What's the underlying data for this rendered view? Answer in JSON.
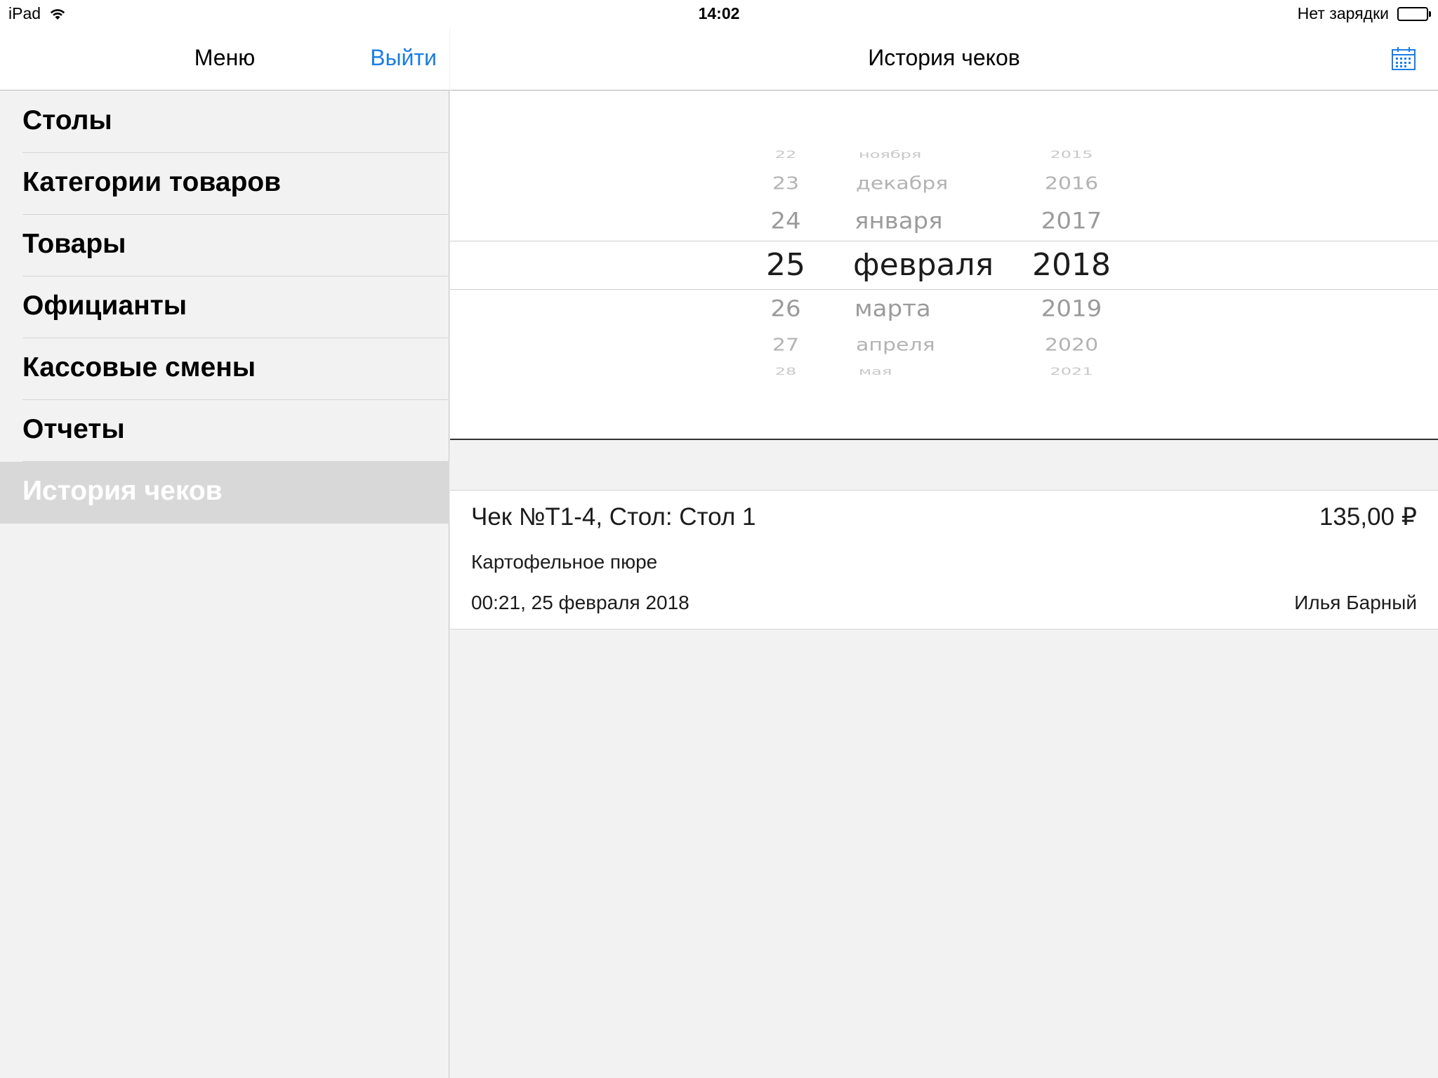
{
  "status_bar": {
    "device": "iPad",
    "time": "14:02",
    "charging": "Нет зарядки",
    "battery_level": 1.0
  },
  "sidebar": {
    "title": "Меню",
    "logout_label": "Выйти",
    "items": [
      {
        "label": "Столы"
      },
      {
        "label": "Категории товаров"
      },
      {
        "label": "Товары"
      },
      {
        "label": "Официанты"
      },
      {
        "label": "Кассовые смены"
      },
      {
        "label": "Отчеты"
      },
      {
        "label": "История чеков",
        "selected": true
      }
    ]
  },
  "main": {
    "title": "История чеков",
    "calendar_icon": "calendar-icon"
  },
  "date_picker": {
    "day": {
      "above": [
        "22",
        "23",
        "24"
      ],
      "selected": "25",
      "below": [
        "26",
        "27",
        "28"
      ]
    },
    "month": {
      "above": [
        "ноября",
        "декабря",
        "января"
      ],
      "selected": "февраля",
      "below": [
        "марта",
        "апреля",
        "мая"
      ]
    },
    "year": {
      "above": [
        "2015",
        "2016",
        "2017"
      ],
      "selected": "2018",
      "below": [
        "2019",
        "2020",
        "2021"
      ]
    }
  },
  "receipt": {
    "title": "Чек №Т1-4, Стол: Стол 1",
    "amount": "135,00 ₽",
    "items": "Картофельное пюре",
    "datetime": "00:21, 25 февраля 2018",
    "waiter": "Илья Барный"
  },
  "colors": {
    "accent": "#1a7de6",
    "selected_row": "#d8d8d8",
    "background": "#f2f2f2"
  }
}
